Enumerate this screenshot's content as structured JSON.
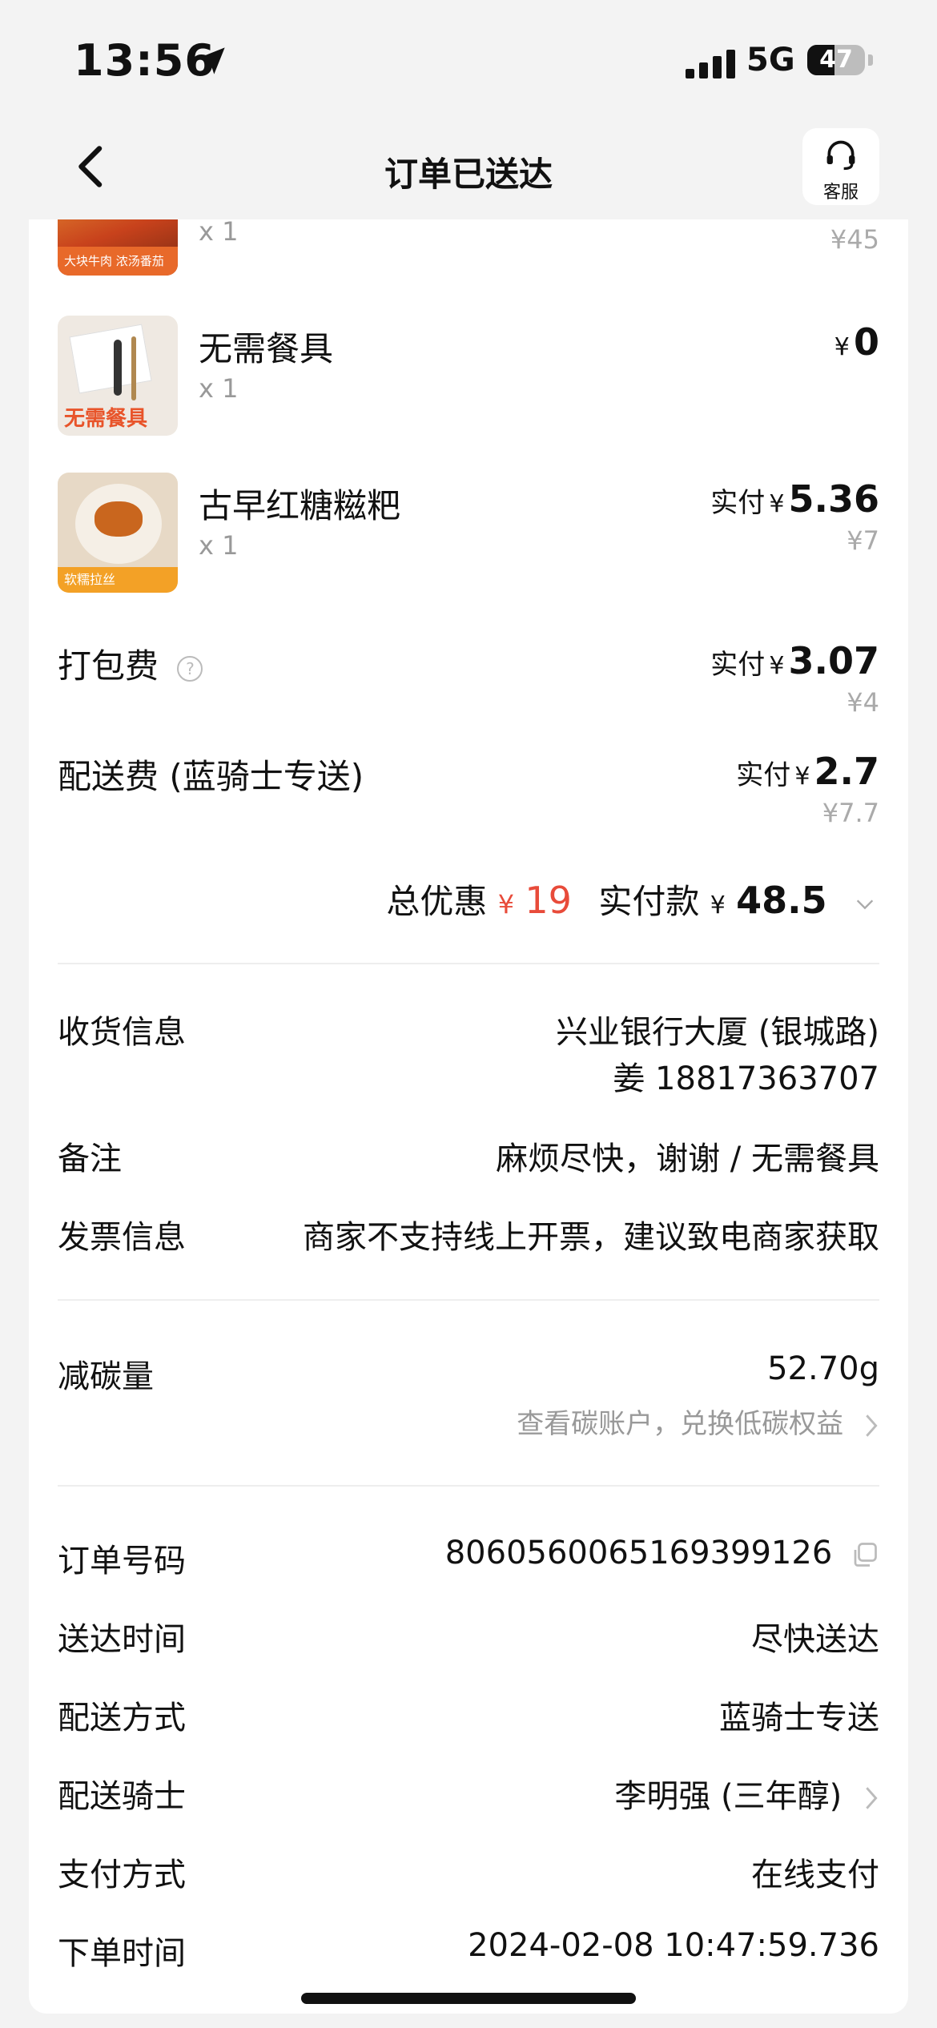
{
  "status_bar": {
    "time": "13:56",
    "network": "5G",
    "battery": "47",
    "battery_level": 0.47
  },
  "nav": {
    "title": "订单已送达",
    "cs_label": "客服"
  },
  "items": [
    {
      "name": "",
      "qty": "x 1",
      "orig": "¥45",
      "badge": "大块牛肉 浓汤番茄"
    },
    {
      "name": "无需餐具",
      "qty": "x 1",
      "yen": "¥",
      "amount": "0",
      "badge": "无需餐具"
    },
    {
      "name": "古早红糖糍粑",
      "qty": "x 1",
      "paid_label": "实付",
      "yen": "¥",
      "amount": "5.36",
      "orig": "¥7",
      "badge": "软糯拉丝"
    }
  ],
  "fees": {
    "packing": {
      "label": "打包费",
      "help_icon": "?",
      "paid_label": "实付",
      "yen": "¥",
      "amount": "3.07",
      "orig": "¥4"
    },
    "delivery": {
      "label": "配送费 (蓝骑士专送)",
      "paid_label": "实付",
      "yen": "¥",
      "amount": "2.7",
      "orig": "¥7.7"
    }
  },
  "totals": {
    "discount_label": "总优惠",
    "discount_yen": "¥",
    "discount_value": "19",
    "paid_label": "实付款",
    "paid_yen": "¥",
    "paid_value": "48.5"
  },
  "info": {
    "receiver_label": "收货信息",
    "receiver_address": "兴业银行大厦 (银城路)",
    "receiver_contact": "姜 18817363707",
    "remark_label": "备注",
    "remark_value": "麻烦尽快，谢谢 / 无需餐具",
    "invoice_label": "发票信息",
    "invoice_value": "商家不支持线上开票，建议致电商家获取"
  },
  "carbon": {
    "label": "减碳量",
    "value": "52.70g",
    "link": "查看碳账户，兑换低碳权益"
  },
  "order": {
    "number_label": "订单号码",
    "number_value": "8060560065169399126",
    "arrive_label": "送达时间",
    "arrive_value": "尽快送达",
    "method_label": "配送方式",
    "method_value": "蓝骑士专送",
    "rider_label": "配送骑士",
    "rider_value": "李明强 (三年醇)",
    "pay_label": "支付方式",
    "pay_value": "在线支付",
    "time_label": "下单时间",
    "time_value": "2024-02-08 10:47:59.736"
  },
  "colors": {
    "accent_red": "#e84b3a",
    "background": "#f3f3f3"
  }
}
